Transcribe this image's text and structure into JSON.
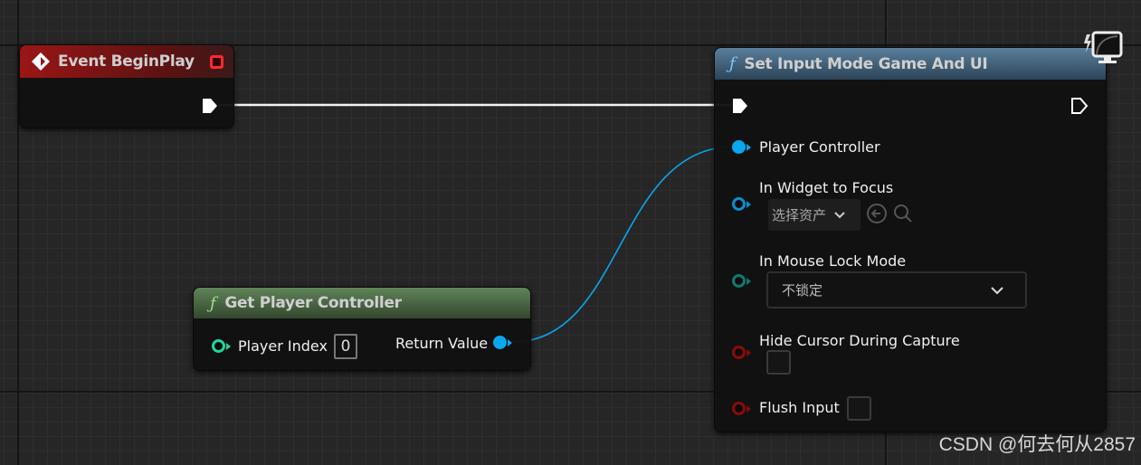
{
  "nodes": {
    "event_begin_play": {
      "title": "Event BeginPlay",
      "header_color": "#8e1a1a"
    },
    "get_player_controller": {
      "title": "Get Player Controller",
      "header_color": "#4f6e48",
      "player_index_label": "Player Index",
      "player_index_value": "0",
      "return_value_label": "Return Value"
    },
    "set_input_mode": {
      "title": "Set Input Mode Game And UI",
      "header_color": "#3d5f7a",
      "player_controller_label": "Player Controller",
      "widget_label": "In Widget to Focus",
      "widget_value": "选择资产",
      "mouse_lock_label": "In Mouse Lock Mode",
      "mouse_lock_value": "不锁定",
      "hide_cursor_label": "Hide Cursor During Capture",
      "hide_cursor_checked": false,
      "flush_input_label": "Flush Input",
      "flush_input_checked": false
    }
  },
  "function_glyph": "ƒ",
  "colors": {
    "object_pin": "#0aa6ee",
    "int_pin": "#1fd6a0",
    "enum_pin": "#0f7a72",
    "bool_pin": "#8a0b0b",
    "exec_wire": "#ffffff"
  },
  "watermark": "CSDN @何去何从2857"
}
